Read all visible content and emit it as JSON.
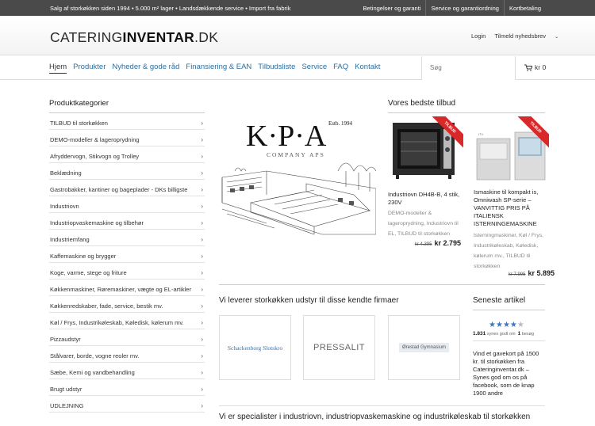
{
  "topbar": {
    "tagline": "Salg af storkøkken siden 1994 • 5.000 m² lager • Landsdækkende service • Import fra fabrik",
    "links": [
      "Betingelser og garanti",
      "Service og garantiordning",
      "Kortbetaling"
    ]
  },
  "header": {
    "logo_light": "CATERING",
    "logo_bold": "INVENTAR",
    "logo_tld": ".DK",
    "login": "Login",
    "newsletter": "Tilmeld nyhedsbrev"
  },
  "nav": {
    "items": [
      "Hjem",
      "Produkter",
      "Nyheder & gode råd",
      "Finansiering & EAN",
      "Tilbudsliste",
      "Service",
      "FAQ",
      "Kontakt"
    ],
    "search_placeholder": "Søg",
    "cart": "kr 0"
  },
  "sidebar": {
    "title": "Produktkategorier",
    "items": [
      "TILBUD til storkøkken",
      "DEMO-modeller & lageroprydning",
      "Afryddervogn, Stikvogn og Trolley",
      "Beklædning",
      "Gastrobakker, kantiner og bageplader - DKs billigste",
      "Industriovn",
      "Industriopvaskemaskine og tilbehør",
      "Industriemfang",
      "Kaffemaskine og brygger",
      "Koge, varme, stege og friture",
      "Køkkenmaskiner, Røremaskiner, vægte og EL-artikler",
      "Køkkenredskaber, fade, service, bestik mv.",
      "Køl / Frys, Industrikøleskab, Køledisk, kølerum mv.",
      "Pizzaudstyr",
      "Stålvarer, borde, vogne reoler mv.",
      "Sæbe, Kemi og vandbehandling",
      "Brugt udstyr",
      "UDLEJNING"
    ]
  },
  "hero": {
    "letters": "K·P·A",
    "estb": "Estb. 1994",
    "company": "COMPANY APS"
  },
  "offers": {
    "title": "Vores bedste tilbud",
    "ribbon": "TILBUD",
    "products": [
      {
        "name": "Industriovn DH4B-B, 4 stik, 230V",
        "categories": "DEMO-modeller & lageroprydning, Industriovn til EL, TILBUD til storkøkken",
        "old_price": "kr 4.395",
        "price": "kr 2.795"
      },
      {
        "name": "Ismaskine til kompakt is, Omniwash SP-serie – VANVITTIG PRIS PÅ ITALIENSK ISTERNINGEMASKINE",
        "categories": "Isterningmaskiner, Køl / Frys, Industrikøleskab, Køledisk, kølerum mv., TILBUD til storkøkken",
        "old_price": "kr 7.995",
        "price": "kr 5.895"
      }
    ]
  },
  "brands": {
    "title": "Vi leverer storkøkken udstyr til disse kendte firmaer",
    "names": [
      "Schackenborg Slotskro",
      "PRESSALIT",
      "Ørestad Gymnasium"
    ]
  },
  "article": {
    "title": "Seneste artikel",
    "rating": 4,
    "votes_count": "1.831",
    "votes_label": "synes godt om",
    "visits_count": "1",
    "visits_label": "besøg",
    "text": "Vind et gavekort på 1500 kr. til storkøkken fra Cateringinventar.dk – Synes god om os på facebook, som de knap 1900 andre"
  },
  "spec_heading": "Vi er specialister i industriovn, industriopvaskemaskine og industrikøleskab til storkøkken",
  "colors": {
    "accent": "#2a6fa0",
    "topbar": "#4a4a4a",
    "ribbon": "#d8282a",
    "stars": "#3b76c4"
  }
}
